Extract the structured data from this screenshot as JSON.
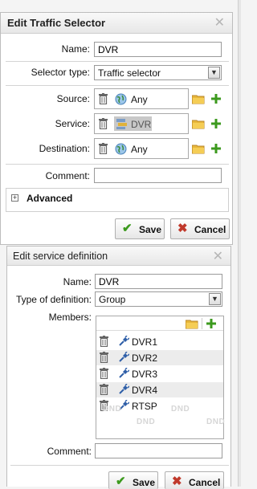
{
  "colors": {
    "accent_green": "#3c9a1e",
    "cancel_red": "#c0392b",
    "title_bg": "#ececec"
  },
  "dialog1": {
    "title": "Edit Traffic Selector",
    "close_icon": "close-x-icon",
    "name_label": "Name:",
    "name_value": "DVR",
    "selector_type_label": "Selector type:",
    "selector_type_value": "Traffic selector",
    "source_label": "Source:",
    "source_value": "Any",
    "service_label": "Service:",
    "service_value": "DVR",
    "destination_label": "Destination:",
    "destination_value": "Any",
    "comment_label": "Comment:",
    "comment_value": "",
    "advanced_label": "Advanced",
    "save_label": "Save",
    "cancel_label": "Cancel"
  },
  "dialog2": {
    "title": "Edit service definition",
    "close_icon": "close-x-icon",
    "name_label": "Name:",
    "name_value": "DVR",
    "type_label": "Type of definition:",
    "type_value": "Group",
    "members_label": "Members:",
    "members": [
      {
        "name": "DVR1",
        "icon": "plug-icon"
      },
      {
        "name": "DVR2",
        "icon": "plug-icon"
      },
      {
        "name": "DVR3",
        "icon": "plug-icon"
      },
      {
        "name": "DVR4",
        "icon": "plug-icon"
      },
      {
        "name": "RTSP",
        "icon": "plug-icon"
      }
    ],
    "dnd_watermark": "DND",
    "comment_label": "Comment:",
    "comment_value": "",
    "save_label": "Save",
    "cancel_label": "Cancel"
  }
}
